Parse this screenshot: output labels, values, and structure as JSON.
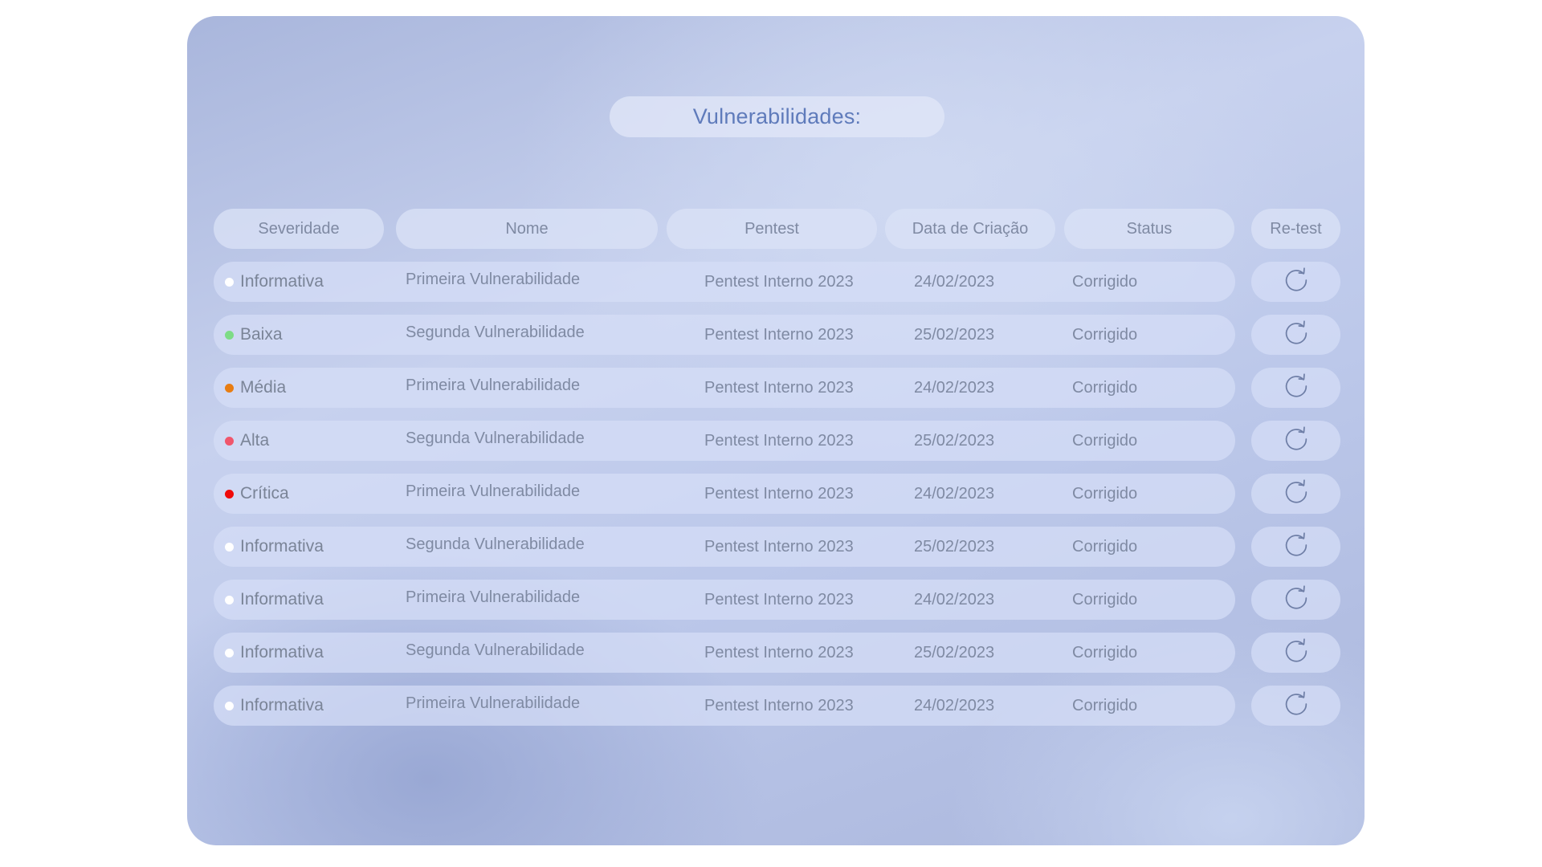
{
  "title": "Vulnerabilidades:",
  "columns": {
    "severidade": "Severidade",
    "nome": "Nome",
    "pentest": "Pentest",
    "data": "Data de Criação",
    "status": "Status",
    "retest": "Re-test"
  },
  "severity_colors": {
    "Informativa": "#ffffff",
    "Baixa": "#7ddc86",
    "Média": "#e87d12",
    "Alta": "#f0566c",
    "Crítica": "#f00a0a"
  },
  "rows": [
    {
      "severidade": "Informativa",
      "nome": "Primeira Vulnerabilidade",
      "pentest": "Pentest Interno 2023",
      "data": "24/02/2023",
      "status": "Corrigido",
      "retest_icon": "refresh-icon"
    },
    {
      "severidade": "Baixa",
      "nome": "Segunda Vulnerabilidade",
      "pentest": "Pentest Interno 2023",
      "data": "25/02/2023",
      "status": "Corrigido",
      "retest_icon": "refresh-icon"
    },
    {
      "severidade": "Média",
      "nome": "Primeira Vulnerabilidade",
      "pentest": "Pentest Interno 2023",
      "data": "24/02/2023",
      "status": "Corrigido",
      "retest_icon": "refresh-icon"
    },
    {
      "severidade": "Alta",
      "nome": "Segunda Vulnerabilidade",
      "pentest": "Pentest Interno 2023",
      "data": "25/02/2023",
      "status": "Corrigido",
      "retest_icon": "refresh-icon"
    },
    {
      "severidade": "Crítica",
      "nome": "Primeira Vulnerabilidade",
      "pentest": "Pentest Interno 2023",
      "data": "24/02/2023",
      "status": "Corrigido",
      "retest_icon": "refresh-icon"
    },
    {
      "severidade": "Informativa",
      "nome": "Segunda Vulnerabilidade",
      "pentest": "Pentest Interno 2023",
      "data": "25/02/2023",
      "status": "Corrigido",
      "retest_icon": "refresh-icon"
    },
    {
      "severidade": "Informativa",
      "nome": "Primeira Vulnerabilidade",
      "pentest": "Pentest Interno 2023",
      "data": "24/02/2023",
      "status": "Corrigido",
      "retest_icon": "refresh-icon"
    },
    {
      "severidade": "Informativa",
      "nome": "Segunda Vulnerabilidade",
      "pentest": "Pentest Interno 2023",
      "data": "25/02/2023",
      "status": "Corrigido",
      "retest_icon": "refresh-icon"
    },
    {
      "severidade": "Informativa",
      "nome": "Primeira Vulnerabilidade",
      "pentest": "Pentest Interno 2023",
      "data": "24/02/2023",
      "status": "Corrigido",
      "retest_icon": "refresh-icon"
    }
  ]
}
